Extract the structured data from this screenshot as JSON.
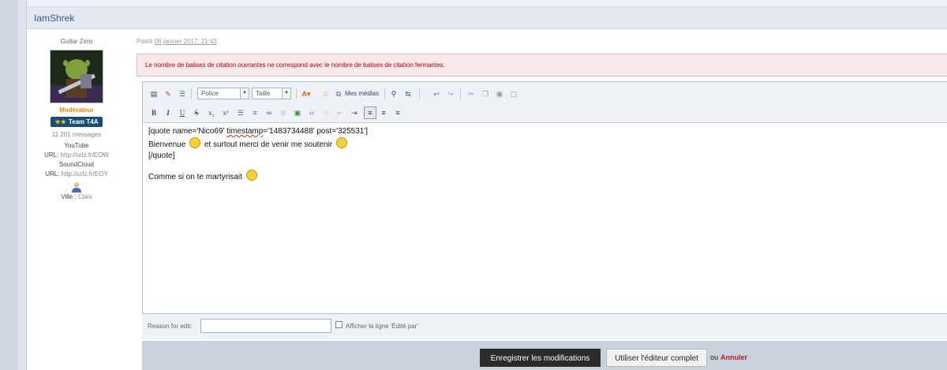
{
  "post": {
    "author": "IamShrek",
    "meta_prefix": "Posté",
    "meta_date": "06 janvier 2017, 21:43"
  },
  "profile": {
    "rank": "Guitar Zero",
    "group_title": "Modérateur",
    "team_badge": "Team T4A",
    "message_count": "11 201 messages",
    "youtube_label": "YouTube",
    "youtube_url_label": "URL:",
    "youtube_url": "http://urlz.fr/EOW",
    "soundcloud_label": "SoundCloud",
    "soundcloud_url_label": "URL:",
    "soundcloud_url": "http://urlz.fr/EOY",
    "city_label": "Ville :",
    "city": "Claix"
  },
  "error": {
    "message": "Le nombre de balises de citation ouvrantes ne correspond avec le nombre de balises de citation fermantes."
  },
  "toolbar": {
    "font_select": "Police",
    "size_select": "Taille",
    "media_label": "Mes médias",
    "bold": "B",
    "italic": "I",
    "underline": "U",
    "strike": "S",
    "subscript": "x₂",
    "superscript": "x²"
  },
  "editor": {
    "line1_a": "[quote name='Nico69' ",
    "line1_b": "timestamp",
    "line1_c": "='1483734488' post='325531']",
    "line2_a": "Bienvenue",
    "line2_b": "et surtout merci de venir me soutenir",
    "line3": "[/quote]",
    "line4": "Comme si on te martyrisait"
  },
  "edit_reason": {
    "label": "Reason for edit:",
    "value": "",
    "checkbox_label": "Afficher la ligne 'Édité par'"
  },
  "actions": {
    "save": "Enregistrer les modifications",
    "full_editor": "Utiliser l'éditeur complet",
    "or": "ou",
    "cancel": "Annuler"
  },
  "colors": {
    "accent": "#2e5b93",
    "error_text": "#b00000",
    "moderator": "#e98a00",
    "cancel": "#b52020"
  }
}
